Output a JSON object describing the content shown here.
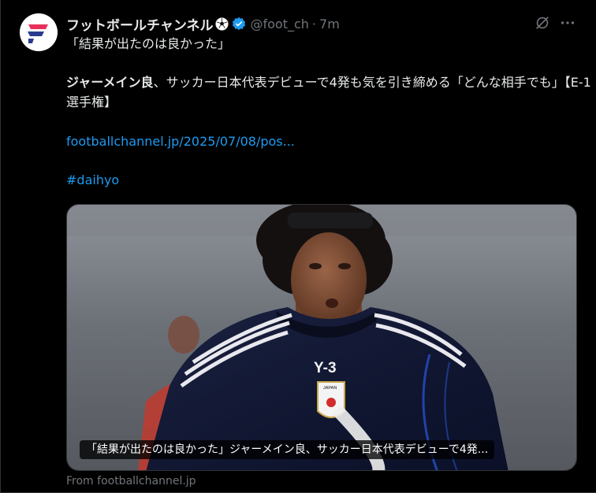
{
  "author": {
    "display_name": "フットボールチャンネル",
    "handle": "@foot_ch",
    "separator": "·",
    "timestamp": "7m",
    "avatar_icon": "footballchannel-logo",
    "badge_icon": "soccer-ball-icon",
    "verified_icon": "verified-badge-icon"
  },
  "post": {
    "quote_line": "「結果が出たのは良かった」",
    "headline_bold": "ジャーメイン良",
    "headline_rest": "、サッカー日本代表デビューで4発も気を引き締める「どんな相手でも」【E-1選手権】",
    "link": "footballchannel.jp/2025/07/08/pos...",
    "hashtag": "#daihyo"
  },
  "card": {
    "caption": "「結果が出たのは良かった」ジャーメイン良、サッカー日本代表デビューで4発...",
    "shirt_brand": "Y-3",
    "crest_text": "JAPAN",
    "source": "From footballchannel.jp"
  },
  "actions": {
    "grok_icon": "grok-icon",
    "more_icon": "more-icon"
  },
  "colors": {
    "background": "#000000",
    "text": "#e7e9ea",
    "secondary": "#71767b",
    "link": "#1d9bf0",
    "verified": "#1d9bf0"
  }
}
